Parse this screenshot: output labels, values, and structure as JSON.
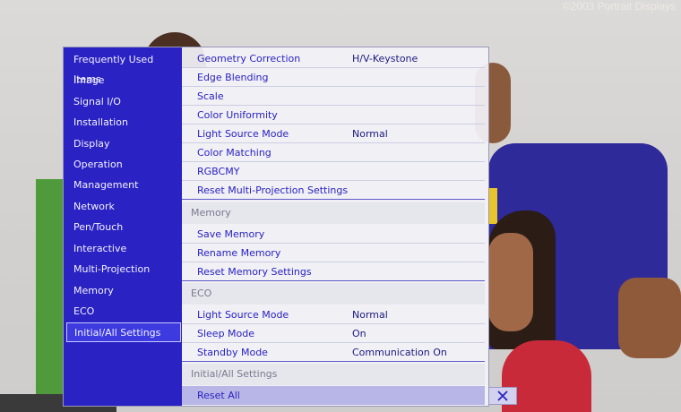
{
  "watermark": "©2003 Portrait Displays",
  "sidebar": {
    "items": [
      {
        "label": "Frequently Used Items"
      },
      {
        "label": "Image"
      },
      {
        "label": "Signal I/O"
      },
      {
        "label": "Installation"
      },
      {
        "label": "Display"
      },
      {
        "label": "Operation"
      },
      {
        "label": "Management"
      },
      {
        "label": "Network"
      },
      {
        "label": "Pen/Touch"
      },
      {
        "label": "Interactive"
      },
      {
        "label": "Multi-Projection"
      },
      {
        "label": "Memory"
      },
      {
        "label": "ECO"
      },
      {
        "label": "Initial/All Settings"
      }
    ],
    "selected": "Initial/All Settings"
  },
  "panel": {
    "multi_projection": [
      {
        "label": "Geometry Correction",
        "value": "H/V-Keystone"
      },
      {
        "label": "Edge Blending",
        "value": ""
      },
      {
        "label": "Scale",
        "value": ""
      },
      {
        "label": "Color Uniformity",
        "value": ""
      },
      {
        "label": "Light Source Mode",
        "value": "Normal"
      },
      {
        "label": "Color Matching",
        "value": ""
      },
      {
        "label": "RGBCMY",
        "value": ""
      },
      {
        "label": "Reset Multi-Projection Settings",
        "value": ""
      }
    ],
    "memory": {
      "header": "Memory",
      "items": [
        {
          "label": "Save Memory"
        },
        {
          "label": "Rename Memory"
        },
        {
          "label": "Reset Memory Settings"
        }
      ]
    },
    "eco": {
      "header": "ECO",
      "items": [
        {
          "label": "Light Source Mode",
          "value": "Normal"
        },
        {
          "label": "Sleep Mode",
          "value": "On"
        },
        {
          "label": "Standby Mode",
          "value": "Communication On"
        }
      ]
    },
    "initial": {
      "header": "Initial/All Settings",
      "items": [
        {
          "label": "Reset All"
        }
      ]
    }
  },
  "close_icon": "close-x-icon",
  "colors": {
    "sidebar_bg": "#2a22c2",
    "selected_bg": "#3d3ae0",
    "text_blue": "#2a22c2",
    "highlight": "#b8b6e6"
  }
}
